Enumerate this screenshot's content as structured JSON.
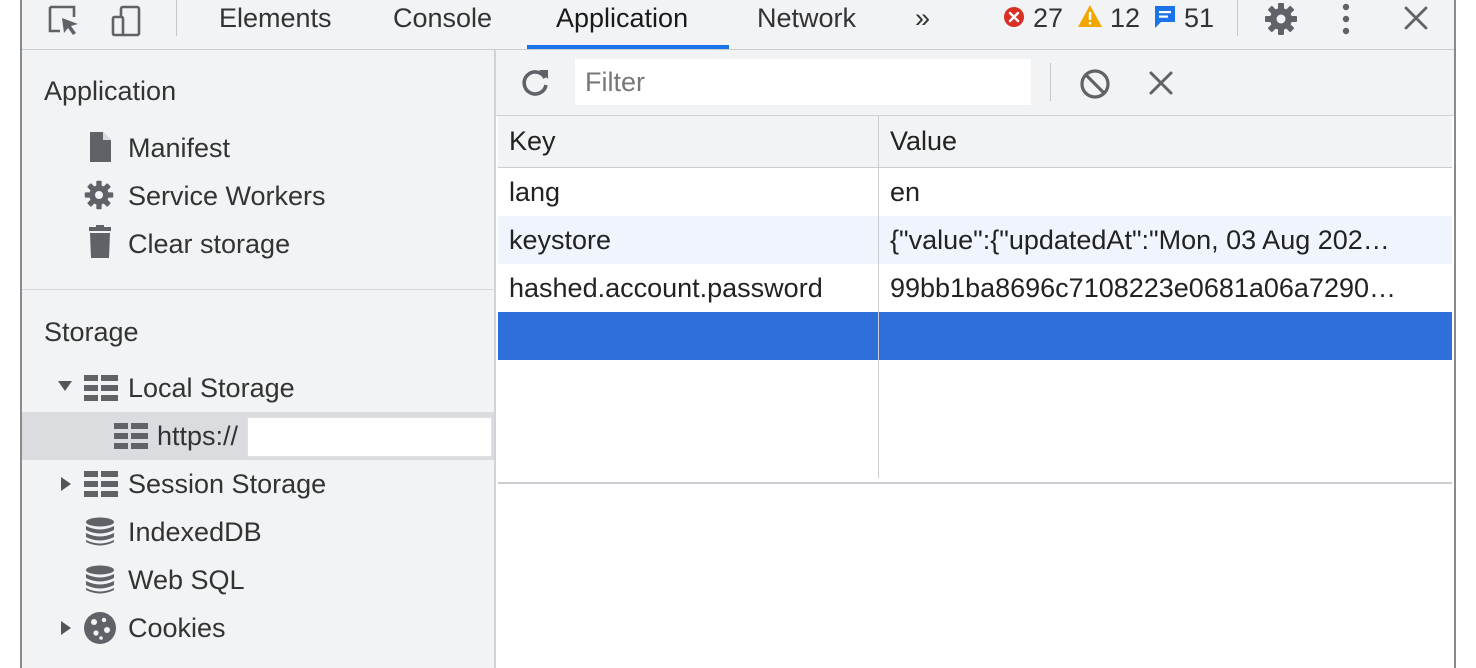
{
  "toolbar": {
    "tabs": [
      {
        "label": "Elements"
      },
      {
        "label": "Console"
      },
      {
        "label": "Application"
      },
      {
        "label": "Network"
      }
    ],
    "more_tabs_glyph": "»",
    "errors_count": "27",
    "warnings_count": "12",
    "messages_count": "51",
    "colors": {
      "accent": "#1a73e8",
      "error": "#d93025",
      "warning": "#f2a600",
      "info": "#1a73e8"
    }
  },
  "sidebar": {
    "application_heading": "Application",
    "application_items": [
      {
        "label": "Manifest",
        "icon": "document-icon"
      },
      {
        "label": "Service Workers",
        "icon": "gear-icon"
      },
      {
        "label": "Clear storage",
        "icon": "trash-icon"
      }
    ],
    "storage_heading": "Storage",
    "storage_items": [
      {
        "label": "Local Storage",
        "icon": "table-icon",
        "expanded": true
      },
      {
        "label": "https://",
        "icon": "table-icon",
        "selected": true
      },
      {
        "label": "Session Storage",
        "icon": "table-icon",
        "expanded": false
      },
      {
        "label": "IndexedDB",
        "icon": "database-icon"
      },
      {
        "label": "Web SQL",
        "icon": "database-icon"
      },
      {
        "label": "Cookies",
        "icon": "cookie-icon",
        "expanded": false
      }
    ]
  },
  "filter": {
    "placeholder": "Filter",
    "value": ""
  },
  "table": {
    "columns": [
      "Key",
      "Value"
    ],
    "rows": [
      {
        "key": "lang",
        "value": "en"
      },
      {
        "key": "keystore",
        "value": "{\"value\":{\"updatedAt\":\"Mon, 03 Aug 202…"
      },
      {
        "key": "hashed.account.password",
        "value": "99bb1ba8696c7108223e0681a06a7290…"
      },
      {
        "key": "",
        "value": "",
        "selected": true
      }
    ],
    "selection_color": "#2f6fd9"
  }
}
